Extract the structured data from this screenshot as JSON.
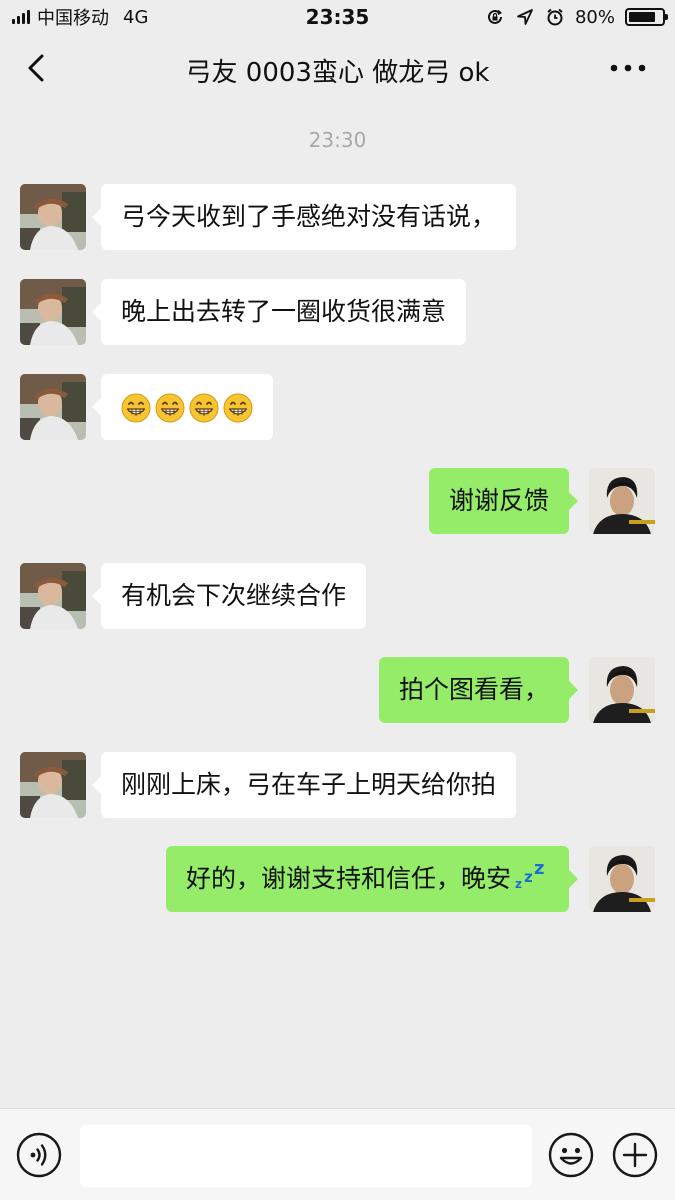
{
  "status_bar": {
    "carrier": "中国移动",
    "network": "4G",
    "time": "23:35",
    "battery_percent": "80%",
    "battery_level": 0.8,
    "icons": [
      "signal-icon",
      "lock-rotation-icon",
      "location-arrow-icon",
      "alarm-icon",
      "battery-icon"
    ]
  },
  "nav": {
    "title": "弓友 0003蛮心  做龙弓 ok",
    "back_icon": "chevron-left-icon",
    "more_icon": "more-dots-icon"
  },
  "chat": {
    "timestamp": "23:30",
    "messages": [
      {
        "side": "left",
        "text": "弓今天收到了手感绝对没有话说，"
      },
      {
        "side": "left",
        "text": "晚上出去转了一圈收货很满意"
      },
      {
        "side": "left",
        "text": "",
        "emoji": "grinning-face-emoji",
        "emoji_count": 4
      },
      {
        "side": "right",
        "text": "谢谢反馈"
      },
      {
        "side": "left",
        "text": "有机会下次继续合作"
      },
      {
        "side": "right",
        "text": "拍个图看看，"
      },
      {
        "side": "left",
        "text": "刚刚上床，弓在车子上明天给你拍"
      },
      {
        "side": "right",
        "text": "好的，谢谢支持和信任，晚安",
        "trailing_emoji": "zzz-emoji"
      }
    ]
  },
  "input_bar": {
    "voice_icon": "voice-icon",
    "emoji_icon": "smiley-icon",
    "plus_icon": "plus-circle-icon",
    "input_value": ""
  },
  "colors": {
    "background": "#ededed",
    "sent_bubble": "#95ec69",
    "received_bubble": "#ffffff",
    "timestamp": "#a8a8a8"
  }
}
